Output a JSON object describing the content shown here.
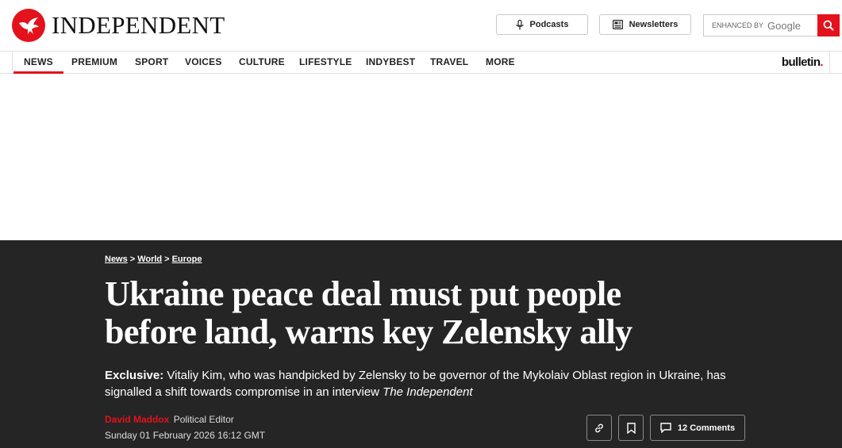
{
  "header": {
    "logo_text": "INDEPENDENT",
    "logo_icon": "eagle-icon",
    "podcasts_label": "Podcasts",
    "newsletters_label": "Newsletters",
    "search_enhanced": "ENHANCED BY",
    "search_google": "Google"
  },
  "nav": {
    "items": [
      {
        "label": "NEWS",
        "active": true
      },
      {
        "label": "PREMIUM"
      },
      {
        "label": "SPORT"
      },
      {
        "label": "VOICES"
      },
      {
        "label": "CULTURE"
      },
      {
        "label": "LIFESTYLE"
      },
      {
        "label": "INDYBEST"
      },
      {
        "label": "TRAVEL"
      },
      {
        "label": "MORE"
      }
    ],
    "bulletin": "bulletin"
  },
  "article": {
    "breadcrumbs": [
      "News",
      "World",
      "Europe"
    ],
    "breadcrumb_separator": ">",
    "headline": "Ukraine peace deal must put people before land, warns key Zelensky ally",
    "standfirst_label": "Exclusive:",
    "standfirst_text": "Vitaliy Kim, who was handpicked by Zelensky to be governor of the Mykolaiv Oblast region in Ukraine, has signalled a shift towards compromise in an interview",
    "standfirst_publication": "The Independent",
    "author": "David Maddox",
    "author_role": "Political Editor",
    "date": "Sunday 01 February 2026 16:12 GMT",
    "comments_label": "12 Comments"
  },
  "colors": {
    "brand_red": "#e3121c",
    "dark_bg": "#252525"
  }
}
